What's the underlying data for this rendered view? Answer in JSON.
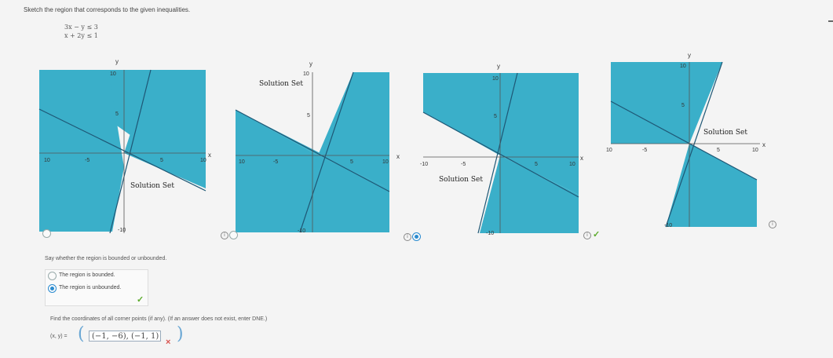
{
  "prompt": "Sketch the region that corresponds to the given inequalities.",
  "inequalities": [
    "3x − y ≤ 3",
    "x + 2y ≤ 1"
  ],
  "graphs": [
    {
      "y_label": "y",
      "x_label": "x",
      "ticks": {
        "x_neg10": "10",
        "x_neg5": "-5",
        "x_5": "5",
        "x_10": "10",
        "y_10": "10",
        "y_5": "5",
        "y_neg10": "-10"
      },
      "solution_label": "Solution Set",
      "selected": false
    },
    {
      "y_label": "y",
      "x_label": "x",
      "ticks": {
        "x_neg10": "10",
        "x_neg5": "-5",
        "x_5": "5",
        "x_10": "10",
        "y_10": "10",
        "y_5": "5",
        "y_neg10": "-10"
      },
      "solution_label": "Solution Set",
      "selected": false
    },
    {
      "y_label": "y",
      "x_label": "x",
      "ticks": {
        "x_neg10": "-10",
        "x_neg5": "-5",
        "x_5": "5",
        "x_10": "10",
        "y_10": "10",
        "y_5": "5",
        "y_neg10": "-10"
      },
      "solution_label": "Solution Set",
      "selected": true
    },
    {
      "y_label": "y",
      "x_label": "x",
      "ticks": {
        "x_neg10": "10",
        "x_neg5": "-5",
        "x_5": "5",
        "x_10": "10",
        "y_10": "10",
        "y_5": "5",
        "y_neg10": "-10"
      },
      "solution_label": "Solution Set",
      "selected": false
    }
  ],
  "info_symbol": "i",
  "bounded_question": "Say whether the region is bounded or unbounded.",
  "options": [
    {
      "label": "The region is bounded.",
      "selected": false
    },
    {
      "label": "The region is unbounded.",
      "selected": true
    }
  ],
  "check_mark": "✓",
  "corner_question": "Find the coordinates of all corner points (if any). (If an answer does not exist, enter DNE.)",
  "answer_prefix": "(x, y) =",
  "answer_value": "(−1, −6), (−1, 1)",
  "wrong_mark": "×",
  "colors": {
    "fill": "#3aafc9",
    "line": "#1e5775",
    "accent": "#2a8bd0",
    "correct": "#5cab2c",
    "wrong": "#d9534f"
  }
}
